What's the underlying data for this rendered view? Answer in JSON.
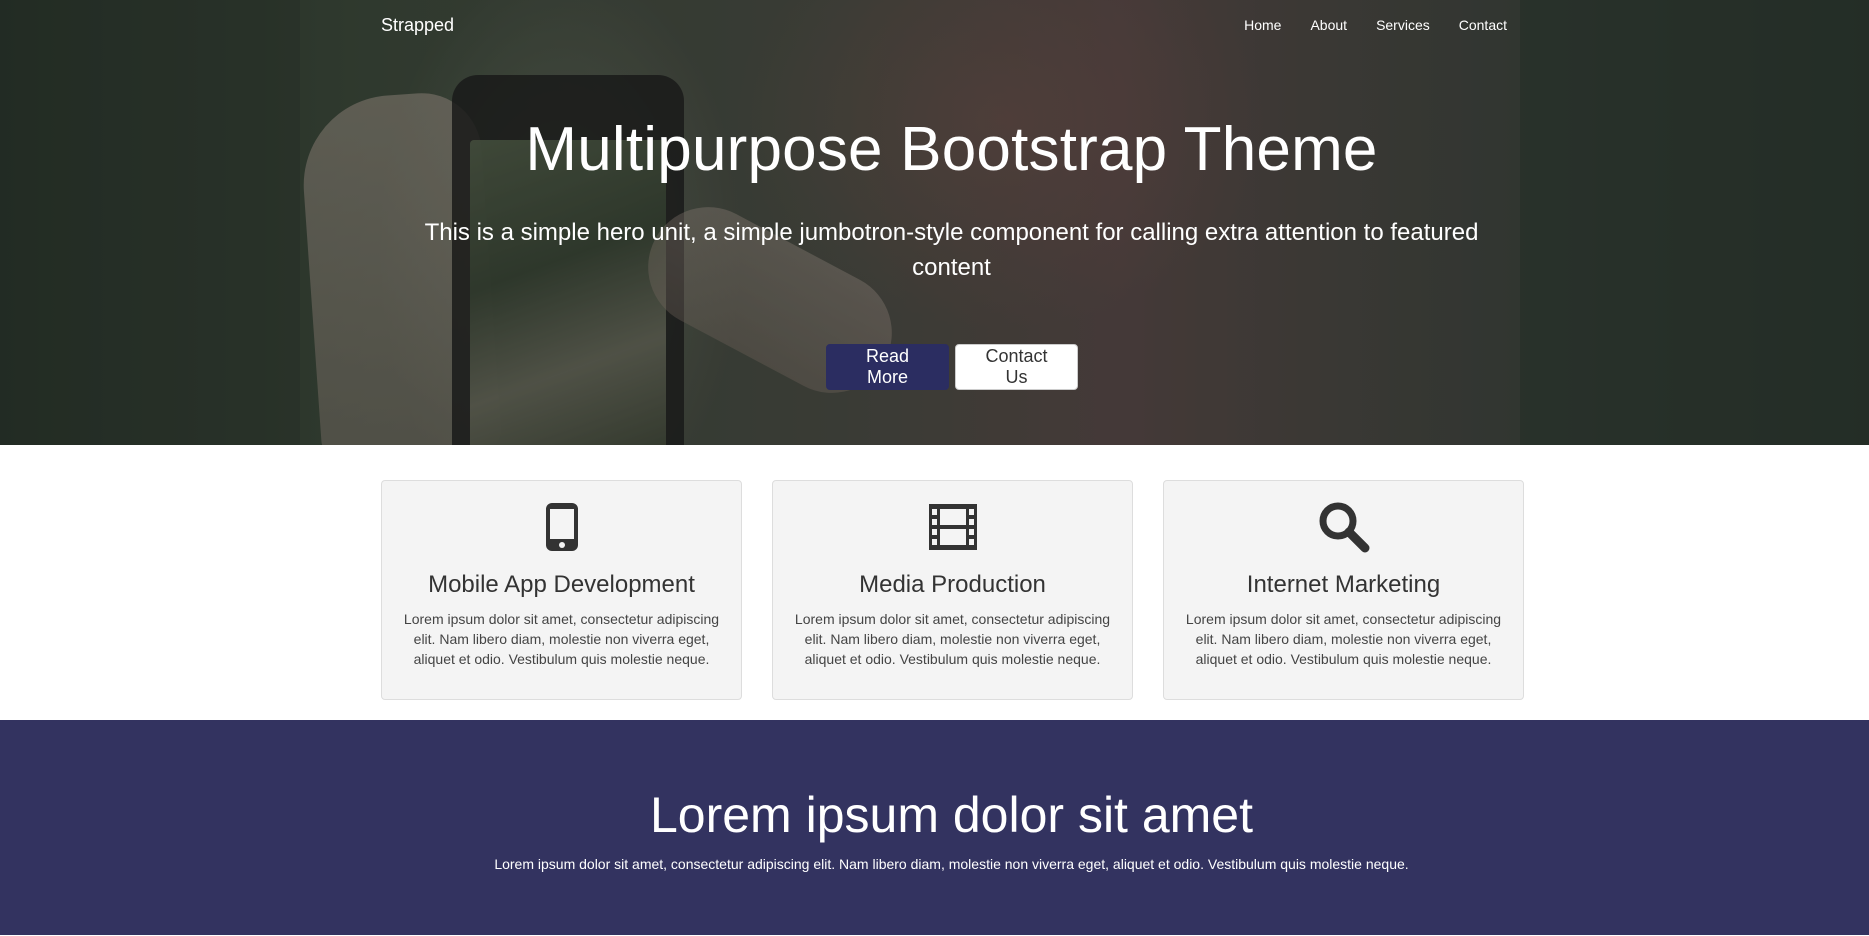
{
  "navbar": {
    "brand": "Strapped",
    "links": [
      "Home",
      "About",
      "Services",
      "Contact"
    ]
  },
  "hero": {
    "title": "Multipurpose Bootstrap Theme",
    "subtitle": "This is a simple hero unit, a simple jumbotron-style component for calling extra attention to featured content",
    "buttons": {
      "primary": "Read More",
      "secondary": "Contact Us"
    }
  },
  "features": [
    {
      "icon": "mobile-phone-icon",
      "title": "Mobile App Development",
      "text": "Lorem ipsum dolor sit amet, consectetur adipiscing elit. Nam libero diam, molestie non viverra eget, aliquet et odio. Vestibulum quis molestie neque."
    },
    {
      "icon": "film-icon",
      "title": "Media Production",
      "text": "Lorem ipsum dolor sit amet, consectetur adipiscing elit. Nam libero diam, molestie non viverra eget, aliquet et odio. Vestibulum quis molestie neque."
    },
    {
      "icon": "search-icon",
      "title": "Internet Marketing",
      "text": "Lorem ipsum dolor sit amet, consectetur adipiscing elit. Nam libero diam, molestie non viverra eget, aliquet et odio. Vestibulum quis molestie neque."
    }
  ],
  "band": {
    "title": "Lorem ipsum dolor sit amet",
    "text": "Lorem ipsum dolor sit amet, consectetur adipiscing elit. Nam libero diam, molestie non viverra eget, aliquet et odio. Vestibulum quis molestie neque."
  },
  "colors": {
    "primary": "#2b2d61",
    "band": "#333360",
    "card_bg": "#f4f4f4"
  }
}
